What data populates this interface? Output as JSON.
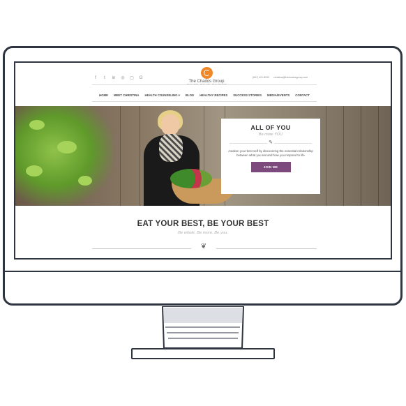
{
  "header": {
    "social_icons": [
      "facebook-icon",
      "twitter-icon",
      "linkedin-icon",
      "pinterest-icon",
      "instagram-icon",
      "google-plus-icon"
    ],
    "logo_name": "The Chados Group",
    "logo_tagline": "REAL FOOD · REAL LIFE · REAL RESULTS",
    "phone": "(847) 421-8033",
    "email": "christina@thechadosgroup.com"
  },
  "nav": {
    "items": [
      "HOME",
      "MEET CHRISTINA",
      "HEALTH COUNSELING",
      "BLOG",
      "HEALTHY RECIPES",
      "SUCCESS STORIES",
      "MEDIA/EVENTS",
      "CONTACT"
    ],
    "dropdown_glyph": "▾"
  },
  "hero": {
    "title": "ALL OF YOU",
    "subtitle": "Be more YOU",
    "body": "Awaken your best self by discovering the essential relationship between what you eat and how you respond to life",
    "button": "JOIN ME",
    "divider_glyph": "✎"
  },
  "section": {
    "tagline": "EAT YOUR BEST, BE YOUR BEST",
    "subtagline": "Be whole. Be more. Be you.",
    "illustration_glyph": "❦"
  },
  "colors": {
    "accent_orange": "#f0882a",
    "button_purple": "#7c4a7c",
    "frame": "#2e3540"
  }
}
